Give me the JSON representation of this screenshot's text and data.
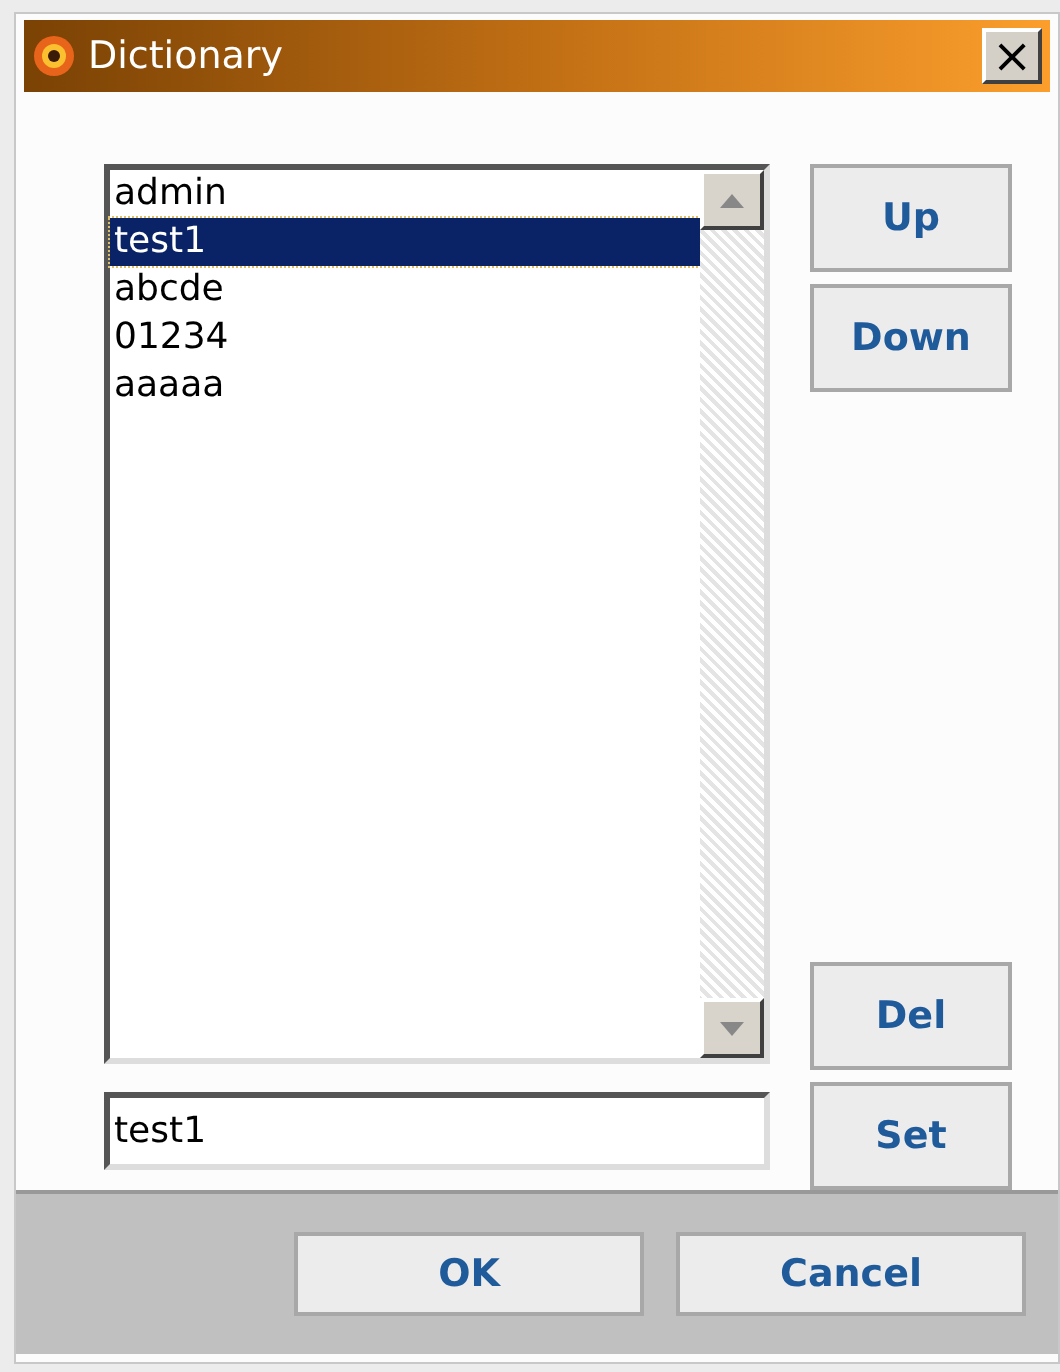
{
  "window": {
    "title": "Dictionary",
    "close": "×"
  },
  "list": {
    "items": [
      {
        "text": "admin",
        "selected": false
      },
      {
        "text": "test1",
        "selected": true
      },
      {
        "text": "abcde",
        "selected": false
      },
      {
        "text": "01234",
        "selected": false
      },
      {
        "text": "aaaaa",
        "selected": false
      }
    ]
  },
  "side_buttons_top": [
    "Up",
    "Down"
  ],
  "side_buttons_bottom": [
    "Del",
    "Set"
  ],
  "entry": {
    "value": "test1"
  },
  "footer_buttons": [
    "OK",
    "Cancel"
  ]
}
